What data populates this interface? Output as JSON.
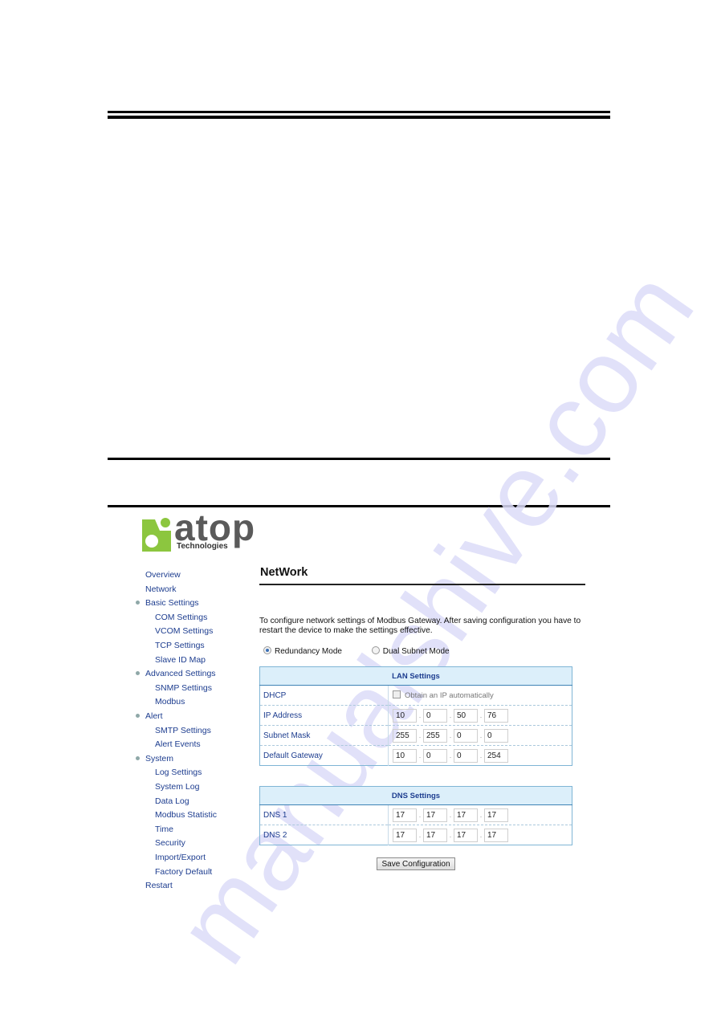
{
  "watermark": "manualshive.com",
  "logo": {
    "brand": "atop",
    "subtitle": "Technologies",
    "colors": {
      "mark": "#8cc63f",
      "word": "#5a5a5a"
    }
  },
  "sidebar": {
    "items": [
      {
        "label": "Overview",
        "level": 0,
        "bullet": false
      },
      {
        "label": "Network",
        "level": 0,
        "bullet": false
      },
      {
        "label": "Basic Settings",
        "level": 0,
        "bullet": true
      },
      {
        "label": "COM Settings",
        "level": 1,
        "bullet": false
      },
      {
        "label": "VCOM Settings",
        "level": 1,
        "bullet": false
      },
      {
        "label": "TCP Settings",
        "level": 1,
        "bullet": false
      },
      {
        "label": "Slave ID Map",
        "level": 1,
        "bullet": false
      },
      {
        "label": "Advanced Settings",
        "level": 0,
        "bullet": true
      },
      {
        "label": "SNMP Settings",
        "level": 1,
        "bullet": false
      },
      {
        "label": "Modbus",
        "level": 1,
        "bullet": false
      },
      {
        "label": "Alert",
        "level": 0,
        "bullet": true
      },
      {
        "label": "SMTP Settings",
        "level": 1,
        "bullet": false
      },
      {
        "label": "Alert Events",
        "level": 1,
        "bullet": false
      },
      {
        "label": "System",
        "level": 0,
        "bullet": true
      },
      {
        "label": "Log Settings",
        "level": 1,
        "bullet": false
      },
      {
        "label": "System Log",
        "level": 1,
        "bullet": false
      },
      {
        "label": "Data Log",
        "level": 1,
        "bullet": false
      },
      {
        "label": "Modbus Statistic",
        "level": 1,
        "bullet": false
      },
      {
        "label": "Time",
        "level": 1,
        "bullet": false
      },
      {
        "label": "Security",
        "level": 1,
        "bullet": false
      },
      {
        "label": "Import/Export",
        "level": 1,
        "bullet": false
      },
      {
        "label": "Factory Default",
        "level": 1,
        "bullet": false
      },
      {
        "label": "Restart",
        "level": 0,
        "bullet": false
      }
    ]
  },
  "main": {
    "title": "NetWork",
    "description": "To configure network settings of Modbus Gateway. After saving configuration you have to restart the device to make the settings effective.",
    "modes": [
      {
        "label": "Redundancy Mode",
        "checked": true
      },
      {
        "label": "Dual Subnet Mode",
        "checked": false
      }
    ],
    "lan": {
      "header": "LAN Settings",
      "dhcp_label": "DHCP",
      "dhcp_checkbox_label": "Obtain an IP automatically",
      "dhcp_checked": false,
      "rows": [
        {
          "label": "IP Address",
          "octets": [
            "10",
            "0",
            "50",
            "76"
          ]
        },
        {
          "label": "Subnet Mask",
          "octets": [
            "255",
            "255",
            "0",
            "0"
          ]
        },
        {
          "label": "Default Gateway",
          "octets": [
            "10",
            "0",
            "0",
            "254"
          ]
        }
      ]
    },
    "dns": {
      "header": "DNS Settings",
      "rows": [
        {
          "label": "DNS 1",
          "octets": [
            "17",
            "17",
            "17",
            "17"
          ]
        },
        {
          "label": "DNS 2",
          "octets": [
            "17",
            "17",
            "17",
            "17"
          ]
        }
      ]
    },
    "save_label": "Save Configuration"
  }
}
